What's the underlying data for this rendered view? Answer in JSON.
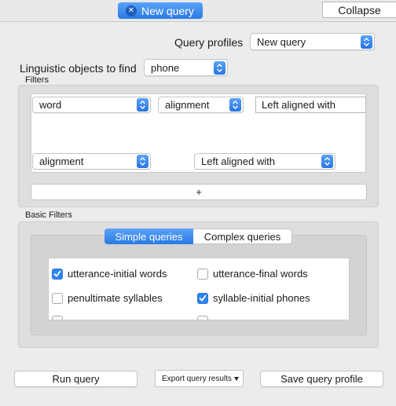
{
  "header": {
    "tab_label": "New query",
    "collapse_label": "Collapse"
  },
  "profiles": {
    "label": "Query profiles",
    "selected": "New query"
  },
  "objects": {
    "label": "Linguistic objects to find",
    "selected": "phone"
  },
  "filters": {
    "title": "Filters",
    "rows": [
      {
        "object": "word",
        "property": "alignment",
        "relation": "Left aligned with"
      },
      {
        "object": "alignment",
        "relation": "Left aligned with"
      }
    ],
    "add_label": "+"
  },
  "basic_filters": {
    "title": "Basic Filters",
    "tabs": [
      "Simple queries",
      "Complex queries"
    ],
    "options": [
      {
        "label": "utterance-initial words",
        "checked": true
      },
      {
        "label": "utterance-final words",
        "checked": false
      },
      {
        "label": "penultimate syllables",
        "checked": false
      },
      {
        "label": "syllable-initial phones",
        "checked": true
      }
    ]
  },
  "actions": {
    "run": "Run query",
    "export": "Export query results",
    "save": "Save query profile"
  },
  "colors": {
    "accent": "#2a7ae6",
    "panel": "#dedede",
    "background": "#ececec"
  }
}
